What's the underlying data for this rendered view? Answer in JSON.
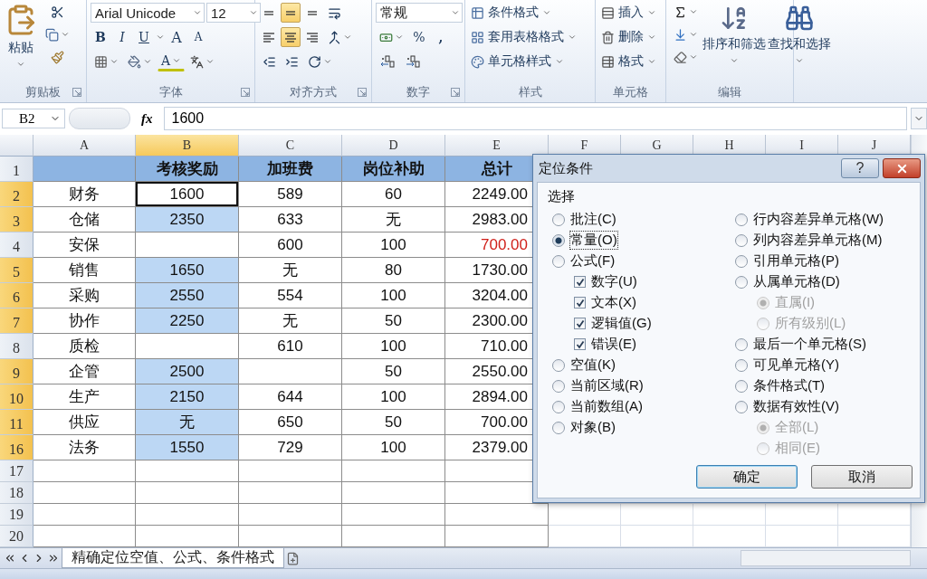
{
  "ribbon": {
    "clipboard": {
      "paste": "粘贴",
      "label": "剪贴板"
    },
    "font": {
      "font_name": "Arial Unicode",
      "font_size": "12",
      "bold": "B",
      "italic": "I",
      "underline": "U",
      "grow": "A",
      "shrink": "A",
      "font_color": "A",
      "label": "字体"
    },
    "alignment": {
      "buttons": [
        {
          "kind": "top",
          "selected": false
        },
        {
          "kind": "middle",
          "selected": true
        },
        {
          "kind": "bottom",
          "selected": false
        },
        {
          "kind": "left",
          "selected": false
        },
        {
          "kind": "center",
          "selected": true
        },
        {
          "kind": "right",
          "selected": false
        }
      ],
      "label": "对齐方式"
    },
    "number": {
      "format": "常规",
      "percent": "%",
      "comma": ",",
      "label": "数字"
    },
    "styles": {
      "items": [
        "条件格式",
        "套用表格格式",
        "单元格样式"
      ],
      "label": "样式"
    },
    "cells": {
      "items": [
        "插入",
        "删除",
        "格式"
      ],
      "label": "单元格"
    },
    "editing": {
      "sort": "排序和筛选",
      "find": "查找和选择",
      "label": "编辑"
    }
  },
  "formula_bar": {
    "name_box": "B2",
    "function_label": "fx",
    "value": "1600"
  },
  "sheet": {
    "columns": [
      {
        "label": "A",
        "selected": false
      },
      {
        "label": "B",
        "selected": true
      },
      {
        "label": "C",
        "selected": false
      },
      {
        "label": "D",
        "selected": false
      },
      {
        "label": "E",
        "selected": false
      },
      {
        "label": "F",
        "selected": false
      },
      {
        "label": "G",
        "selected": false
      },
      {
        "label": "H",
        "selected": false
      },
      {
        "label": "I",
        "selected": false
      },
      {
        "label": "J",
        "selected": false
      }
    ],
    "header_row": {
      "number": "1",
      "cells": [
        "考核奖励",
        "加班费",
        "岗位补助",
        "总计"
      ]
    },
    "rows": [
      {
        "number": "2",
        "selected": true,
        "active": true,
        "total_warning": false,
        "cells": [
          "财务",
          "1600",
          "589",
          "60",
          "2249.00"
        ]
      },
      {
        "number": "3",
        "selected": true,
        "active": false,
        "total_warning": false,
        "cells": [
          "仓储",
          "2350",
          "633",
          "无",
          "2983.00"
        ]
      },
      {
        "number": "4",
        "selected": false,
        "active": false,
        "total_warning": true,
        "cells": [
          "安保",
          null,
          "600",
          "100",
          "700.00"
        ]
      },
      {
        "number": "5",
        "selected": true,
        "active": false,
        "total_warning": false,
        "cells": [
          "销售",
          "1650",
          "无",
          "80",
          "1730.00"
        ]
      },
      {
        "number": "6",
        "selected": true,
        "active": false,
        "total_warning": false,
        "cells": [
          "采购",
          "2550",
          "554",
          "100",
          "3204.00"
        ]
      },
      {
        "number": "7",
        "selected": true,
        "active": false,
        "total_warning": false,
        "cells": [
          "协作",
          "2250",
          "无",
          "50",
          "2300.00"
        ]
      },
      {
        "number": "8",
        "selected": false,
        "active": false,
        "total_warning": false,
        "cells": [
          "质检",
          null,
          "610",
          "100",
          "710.00"
        ]
      },
      {
        "number": "9",
        "selected": true,
        "active": false,
        "total_warning": false,
        "cells": [
          "企管",
          "2500",
          null,
          "50",
          "2550.00"
        ]
      },
      {
        "number": "10",
        "selected": true,
        "active": false,
        "total_warning": false,
        "cells": [
          "生产",
          "2150",
          "644",
          "100",
          "2894.00"
        ]
      },
      {
        "number": "11",
        "selected": true,
        "active": false,
        "total_warning": false,
        "cells": [
          "供应",
          "无",
          "650",
          "50",
          "700.00"
        ]
      },
      {
        "number": "16",
        "selected": true,
        "active": false,
        "total_warning": false,
        "cells": [
          "法务",
          "1550",
          "729",
          "100",
          "2379.00"
        ]
      }
    ],
    "empty_rows": [
      "17",
      "18",
      "19",
      "20"
    ]
  },
  "dialog": {
    "title": "定位条件",
    "help": "?",
    "section": "选择",
    "left_options": [
      {
        "kind": "radio",
        "label": "批注(C)",
        "selected": false,
        "disabled": false
      },
      {
        "kind": "radio",
        "label": "常量(O)",
        "selected": true,
        "disabled": false
      },
      {
        "kind": "radio",
        "label": "公式(F)",
        "selected": false,
        "disabled": false,
        "children": [
          {
            "kind": "checkbox",
            "label": "数字(U)",
            "checked": true,
            "disabled": false
          },
          {
            "kind": "checkbox",
            "label": "文本(X)",
            "checked": true,
            "disabled": false
          },
          {
            "kind": "checkbox",
            "label": "逻辑值(G)",
            "checked": true,
            "disabled": false
          },
          {
            "kind": "checkbox",
            "label": "错误(E)",
            "checked": true,
            "disabled": false
          }
        ]
      },
      {
        "kind": "radio",
        "label": "空值(K)",
        "selected": false,
        "disabled": false
      },
      {
        "kind": "radio",
        "label": "当前区域(R)",
        "selected": false,
        "disabled": false
      },
      {
        "kind": "radio",
        "label": "当前数组(A)",
        "selected": false,
        "disabled": false
      },
      {
        "kind": "radio",
        "label": "对象(B)",
        "selected": false,
        "disabled": false
      }
    ],
    "right_options": [
      {
        "kind": "radio",
        "label": "行内容差异单元格(W)",
        "selected": false,
        "disabled": false
      },
      {
        "kind": "radio",
        "label": "列内容差异单元格(M)",
        "selected": false,
        "disabled": false
      },
      {
        "kind": "radio",
        "label": "引用单元格(P)",
        "selected": false,
        "disabled": false
      },
      {
        "kind": "radio",
        "label": "从属单元格(D)",
        "selected": false,
        "disabled": false,
        "children": [
          {
            "kind": "radio",
            "label": "直属(I)",
            "selected": true,
            "disabled": true
          },
          {
            "kind": "radio",
            "label": "所有级别(L)",
            "selected": false,
            "disabled": true
          }
        ]
      },
      {
        "kind": "radio",
        "label": "最后一个单元格(S)",
        "selected": false,
        "disabled": false
      },
      {
        "kind": "radio",
        "label": "可见单元格(Y)",
        "selected": false,
        "disabled": false
      },
      {
        "kind": "radio",
        "label": "条件格式(T)",
        "selected": false,
        "disabled": false
      },
      {
        "kind": "radio",
        "label": "数据有效性(V)",
        "selected": false,
        "disabled": false,
        "children": [
          {
            "kind": "radio",
            "label": "全部(L)",
            "selected": true,
            "disabled": true
          },
          {
            "kind": "radio",
            "label": "相同(E)",
            "selected": false,
            "disabled": true
          }
        ]
      }
    ],
    "buttons": [
      {
        "label": "确定",
        "kind": "default"
      },
      {
        "label": "取消",
        "kind": "normal"
      }
    ]
  },
  "sheet_tabs": {
    "tabs": [
      {
        "label": "精确定位空值、公式、条件格式",
        "selected": true
      }
    ]
  }
}
